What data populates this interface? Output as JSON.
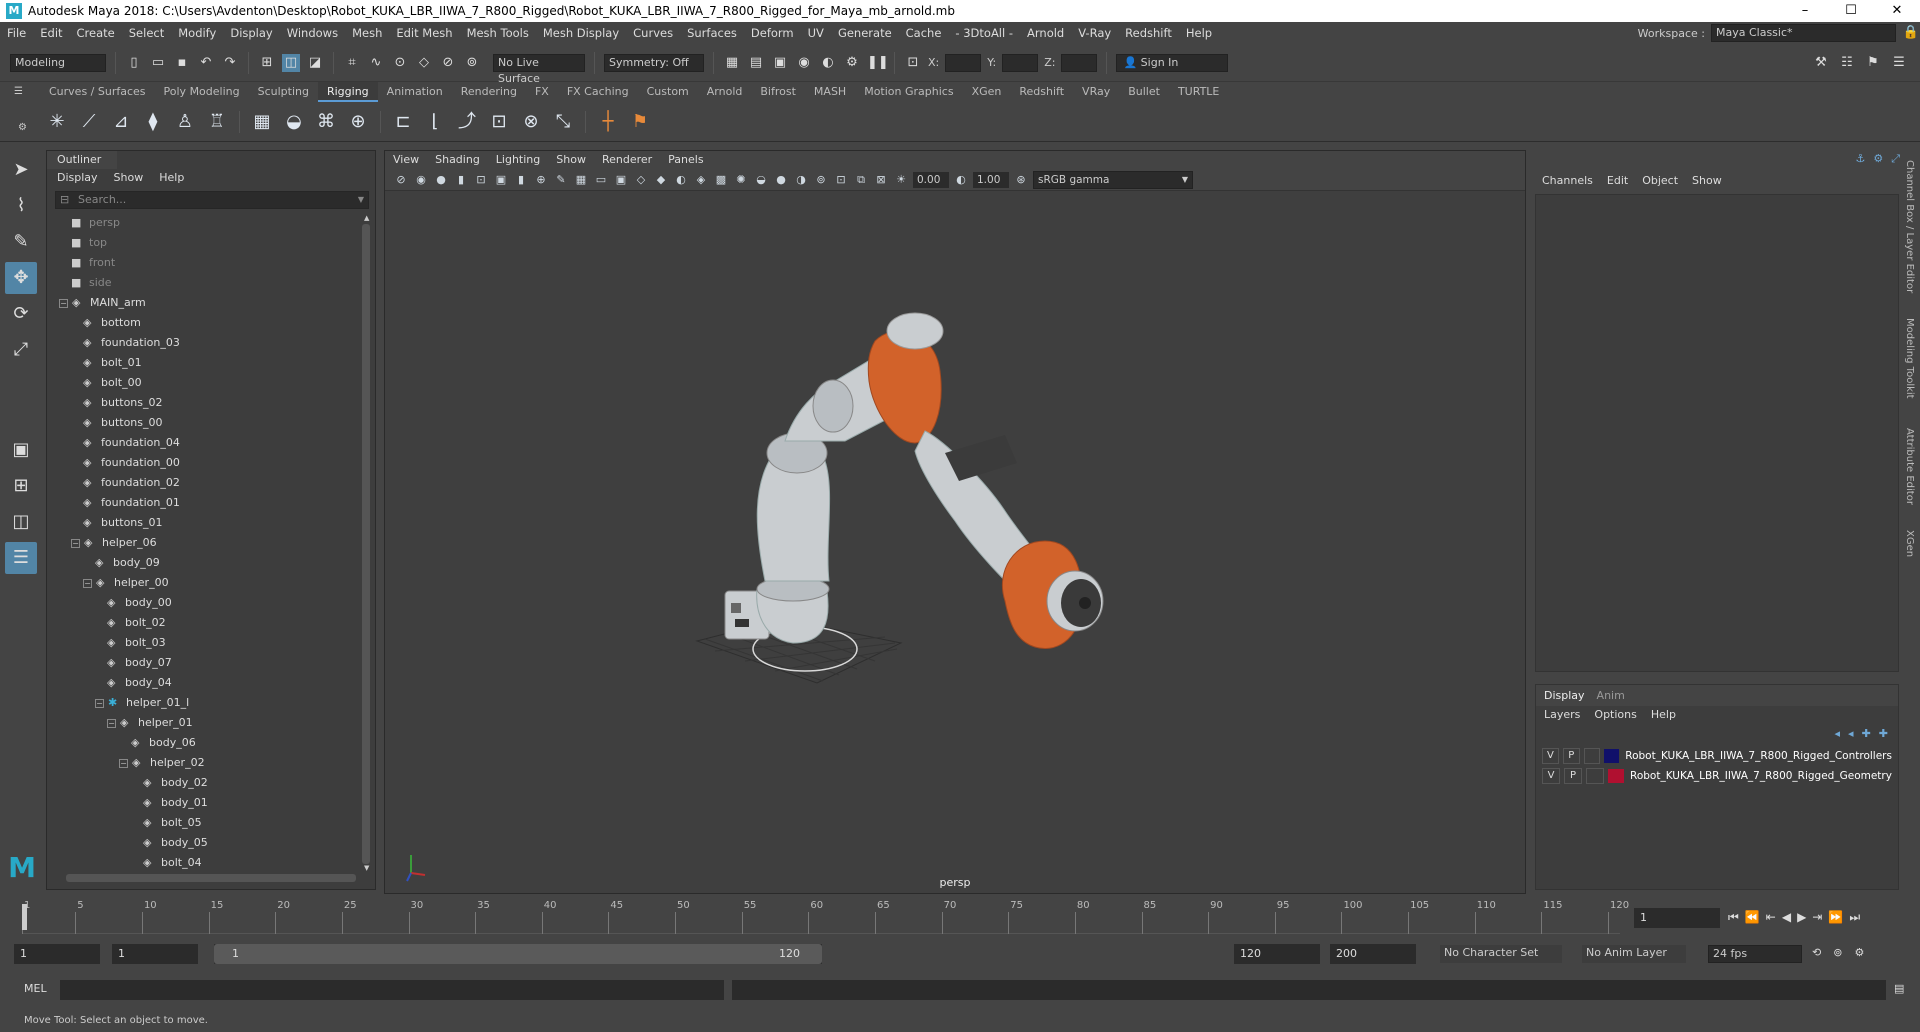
{
  "window": {
    "title": "Autodesk Maya 2018: C:\\Users\\Avdenton\\Desktop\\Robot_KUKA_LBR_IIWA_7_R800_Rigged\\Robot_KUKA_LBR_IIWA_7_R800_Rigged_for_Maya_mb_arnold.mb",
    "controls": [
      "–",
      "☐",
      "✕"
    ]
  },
  "menubar": {
    "items": [
      "File",
      "Edit",
      "Create",
      "Select",
      "Modify",
      "Display",
      "Windows",
      "Mesh",
      "Edit Mesh",
      "Mesh Tools",
      "Mesh Display",
      "Curves",
      "Surfaces",
      "Deform",
      "UV",
      "Generate",
      "Cache",
      "- 3DtoAll -",
      "Arnold",
      "V-Ray",
      "Redshift",
      "Help"
    ],
    "workspace_label": "Workspace :",
    "workspace_value": "Maya Classic*"
  },
  "statusline": {
    "mode": "Modeling",
    "live_surface": "No Live Surface",
    "symmetry": "Symmetry: Off",
    "x_label": "X:",
    "y_label": "Y:",
    "z_label": "Z:",
    "sign_in": "Sign In"
  },
  "shelf": {
    "tabs": [
      "Curves / Surfaces",
      "Poly Modeling",
      "Sculpting",
      "Rigging",
      "Animation",
      "Rendering",
      "FX",
      "FX Caching",
      "Custom",
      "Arnold",
      "Bifrost",
      "MASH",
      "Motion Graphics",
      "XGen",
      "Redshift",
      "VRay",
      "Bullet",
      "TURTLE"
    ],
    "active_tab": "Rigging"
  },
  "outliner": {
    "title": "Outliner",
    "menu": [
      "Display",
      "Show",
      "Help"
    ],
    "search_placeholder": "Search...",
    "items": [
      {
        "label": "persp",
        "depth": 1,
        "type": "camera",
        "dim": true
      },
      {
        "label": "top",
        "depth": 1,
        "type": "camera",
        "dim": true
      },
      {
        "label": "front",
        "depth": 1,
        "type": "camera",
        "dim": true
      },
      {
        "label": "side",
        "depth": 1,
        "type": "camera",
        "dim": true
      },
      {
        "label": "MAIN_arm",
        "depth": 1,
        "type": "group",
        "exp": "-"
      },
      {
        "label": "bottom",
        "depth": 2,
        "type": "mesh"
      },
      {
        "label": "foundation_03",
        "depth": 2,
        "type": "mesh"
      },
      {
        "label": "bolt_01",
        "depth": 2,
        "type": "mesh"
      },
      {
        "label": "bolt_00",
        "depth": 2,
        "type": "mesh"
      },
      {
        "label": "buttons_02",
        "depth": 2,
        "type": "mesh"
      },
      {
        "label": "buttons_00",
        "depth": 2,
        "type": "mesh"
      },
      {
        "label": "foundation_04",
        "depth": 2,
        "type": "mesh"
      },
      {
        "label": "foundation_00",
        "depth": 2,
        "type": "mesh"
      },
      {
        "label": "foundation_02",
        "depth": 2,
        "type": "mesh"
      },
      {
        "label": "foundation_01",
        "depth": 2,
        "type": "mesh"
      },
      {
        "label": "buttons_01",
        "depth": 2,
        "type": "mesh"
      },
      {
        "label": "helper_06",
        "depth": 2,
        "type": "group",
        "exp": "-"
      },
      {
        "label": "body_09",
        "depth": 3,
        "type": "mesh"
      },
      {
        "label": "helper_00",
        "depth": 3,
        "type": "group",
        "exp": "-"
      },
      {
        "label": "body_00",
        "depth": 4,
        "type": "mesh"
      },
      {
        "label": "bolt_02",
        "depth": 4,
        "type": "mesh"
      },
      {
        "label": "bolt_03",
        "depth": 4,
        "type": "mesh"
      },
      {
        "label": "body_07",
        "depth": 4,
        "type": "mesh"
      },
      {
        "label": "body_04",
        "depth": 4,
        "type": "mesh"
      },
      {
        "label": "helper_01_l",
        "depth": 4,
        "type": "locator",
        "exp": "-"
      },
      {
        "label": "helper_01",
        "depth": 5,
        "type": "group",
        "exp": "-"
      },
      {
        "label": "body_06",
        "depth": 6,
        "type": "mesh"
      },
      {
        "label": "helper_02",
        "depth": 6,
        "type": "group",
        "exp": "-"
      },
      {
        "label": "body_02",
        "depth": 7,
        "type": "mesh"
      },
      {
        "label": "body_01",
        "depth": 7,
        "type": "mesh"
      },
      {
        "label": "bolt_05",
        "depth": 7,
        "type": "mesh"
      },
      {
        "label": "body_05",
        "depth": 7,
        "type": "mesh"
      },
      {
        "label": "bolt_04",
        "depth": 7,
        "type": "mesh"
      }
    ]
  },
  "viewport": {
    "menu": [
      "View",
      "Shading",
      "Lighting",
      "Show",
      "Renderer",
      "Panels"
    ],
    "field_a": "0.00",
    "field_b": "1.00",
    "color_space": "sRGB gamma",
    "camera_label": "persp"
  },
  "channelbox": {
    "menu": [
      "Channels",
      "Edit",
      "Object",
      "Show"
    ]
  },
  "layereditor": {
    "tabs": [
      "Display",
      "Anim"
    ],
    "menu": [
      "Layers",
      "Options",
      "Help"
    ],
    "layers": [
      {
        "v": "V",
        "p": "P",
        "color": "#10106a",
        "name": "Robot_KUKA_LBR_IIWA_7_R800_Rigged_Controllers"
      },
      {
        "v": "V",
        "p": "P",
        "color": "#b01030",
        "name": "Robot_KUKA_LBR_IIWA_7_R800_Rigged_Geometry"
      }
    ]
  },
  "sidetabs": [
    "Channel Box / Layer Editor",
    "Modeling Toolkit",
    "Attribute Editor",
    "XGen"
  ],
  "timeslider": {
    "ticks": [
      "1",
      "5",
      "10",
      "15",
      "20",
      "25",
      "30",
      "35",
      "40",
      "45",
      "50",
      "55",
      "60",
      "65",
      "70",
      "75",
      "80",
      "85",
      "90",
      "95",
      "100",
      "105",
      "110",
      "115",
      "120"
    ],
    "current_frame": "1"
  },
  "rangeslider": {
    "start": "1",
    "start2": "1",
    "inner_start": "1",
    "inner_end": "120",
    "end": "120",
    "end2": "200",
    "character_set": "No Character Set",
    "anim_layer": "No Anim Layer",
    "fps": "24 fps"
  },
  "cmdline": {
    "label": "MEL"
  },
  "helpline": {
    "text": "Move Tool: Select an object to move."
  },
  "colors": {
    "accent": "#5285a6",
    "robot_orange": "#d2622a",
    "robot_white": "#c9cdd0"
  }
}
